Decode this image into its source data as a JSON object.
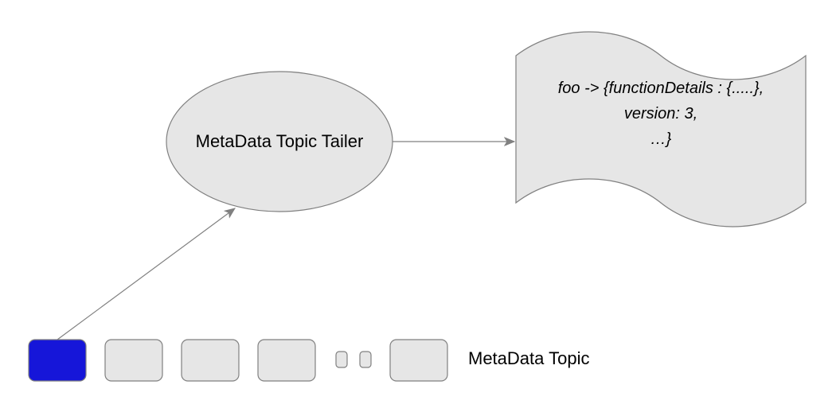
{
  "diagram": {
    "ellipse_label": "MetaData Topic Tailer",
    "topic_label": "MetaData Topic",
    "snippet": {
      "line1": "foo -> {functionDetails : {.....},",
      "line2": "version: 3,",
      "line3": "…}"
    },
    "colors": {
      "shape_fill": "#e6e6e6",
      "shape_stroke": "#808080",
      "active_fill": "#1616d9",
      "arrow": "#808080"
    }
  }
}
